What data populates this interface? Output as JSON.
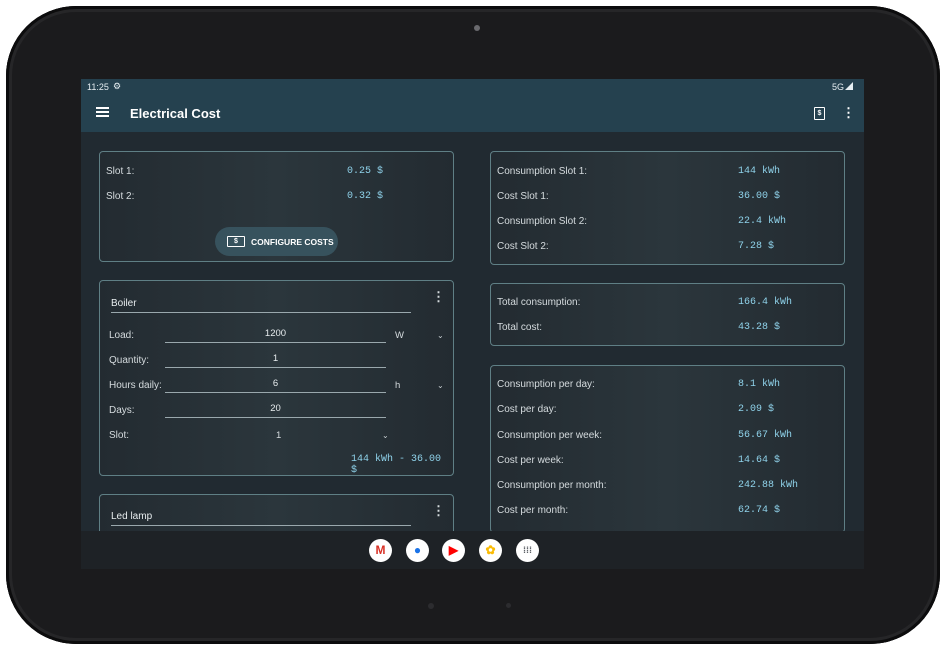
{
  "status": {
    "time": "11:25",
    "network": "5G"
  },
  "appbar": {
    "title": "Electrical Cost"
  },
  "costs_card": {
    "rows": [
      {
        "label": "Slot 1:",
        "value": "0.25 $"
      },
      {
        "label": "Slot 2:",
        "value": "0.32 $"
      }
    ],
    "configure_label": "CONFIGURE COSTS"
  },
  "devices": [
    {
      "name": "Boiler",
      "load_label": "Load:",
      "load_value": "1200",
      "load_unit": "W",
      "quantity_label": "Quantity:",
      "quantity_value": "1",
      "hours_label": "Hours daily:",
      "hours_value": "6",
      "hours_unit": "h",
      "days_label": "Days:",
      "days_value": "20",
      "slot_label": "Slot:",
      "slot_value": "1",
      "summary": "144 kWh - 36.00 $"
    },
    {
      "name": "Led lamp"
    }
  ],
  "slots_summary": [
    {
      "label": "Consumption Slot 1:",
      "value": "144 kWh"
    },
    {
      "label": "Cost Slot 1:",
      "value": "36.00 $"
    },
    {
      "label": "Consumption Slot 2:",
      "value": "22.4 kWh"
    },
    {
      "label": "Cost Slot 2:",
      "value": "7.28 $"
    }
  ],
  "totals": [
    {
      "label": "Total consumption:",
      "value": "166.4 kWh"
    },
    {
      "label": "Total cost:",
      "value": "43.28 $"
    }
  ],
  "periods": [
    {
      "label": "Consumption per day:",
      "value": "8.1 kWh"
    },
    {
      "label": "Cost per day:",
      "value": "2.09 $"
    },
    {
      "label": "Consumption per week:",
      "value": "56.67 kWh"
    },
    {
      "label": "Cost per week:",
      "value": "14.64 $"
    },
    {
      "label": "Consumption per month:",
      "value": "242.88 kWh"
    },
    {
      "label": "Cost per month:",
      "value": "62.74 $"
    }
  ],
  "dock": {
    "apps": [
      {
        "icon": "gmail-icon",
        "glyph": "M",
        "color": "#d93025"
      },
      {
        "icon": "chrome-icon",
        "glyph": "●",
        "color": "#1a73e8"
      },
      {
        "icon": "youtube-icon",
        "glyph": "▶",
        "color": "#ff0000"
      },
      {
        "icon": "photos-icon",
        "glyph": "✿",
        "color": "#fbbc04"
      },
      {
        "icon": "app-drawer-icon",
        "glyph": "⁞⁞⁞",
        "color": "#5f6368"
      }
    ]
  }
}
